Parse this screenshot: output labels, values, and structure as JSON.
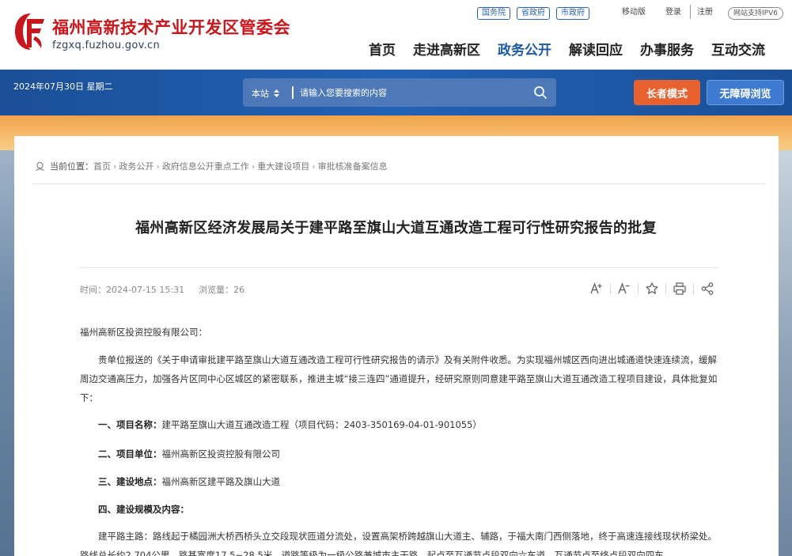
{
  "header": {
    "site_title": "福州高新技术产业开发区管委会",
    "site_url": "fzgxq.fuzhou.gov.cn",
    "top_links": [
      "国务院",
      "省政府",
      "市政府"
    ],
    "mobile": "移动版",
    "login": "登录",
    "register": "注册",
    "ipv6": "网站支持IPV6",
    "nav": [
      "首页",
      "走进高新区",
      "政务公开",
      "解读回应",
      "办事服务",
      "互动交流"
    ],
    "nav_active_index": 2
  },
  "bar": {
    "date": "2024年07月30日 星期二",
    "search_scope": "本站",
    "search_placeholder": "请输入您要搜索的内容",
    "elder_mode": "长者模式",
    "accessible": "无障碍浏览"
  },
  "breadcrumb": {
    "label": "当前位置：",
    "items": [
      "首页",
      "政务公开",
      "政府信息公开重点工作",
      "重大建设项目",
      "审批核准备案信息"
    ]
  },
  "article": {
    "title": "福州高新区经济发展局关于建平路至旗山大道互通改造工程可行性研究报告的批复",
    "time_label": "时间：",
    "time": "2024-07-15 15:31",
    "views_label": "浏览量：",
    "views": "26",
    "salutation": "福州高新区投资控股有限公司：",
    "para1": "贵单位报送的《关于申请审批建平路至旗山大道互通改造工程可行性研究报告的请示》及有关附件收悉。为实现福州城区西向进出城通道快速连续流，缓解周边交通高压力，加强各片区同中心区城区的紧密联系，推进主城“接三连四”通道提升，经研究原则同意建平路至旗山大道互通改造工程项目建设，具体批复如下：",
    "item1_label": "一、项目名称：",
    "item1_value": "建平路至旗山大道互通改造工程（项目代码：2403-350169-04-01-901055）",
    "item2_label": "二、项目单位：",
    "item2_value": "福州高新区投资控股有限公司",
    "item3_label": "三、建设地点：",
    "item3_value": "福州高新区建平路及旗山大道",
    "item4_label": "四、建设规模及内容：",
    "para_last": "建平路主路：路线起于橘园洲大桥西桥头立交段现状匝道分流处，设置高架桥跨越旗山大道主、辅路，于福大南门西侧落地，终于高速连接线现状桥梁处。路线总长约2.704公里，路基宽度17.5~28.5米，道路等级为一级公路兼城市主干路，起点至互通节点段双向六车道，互通节点至终点段双向四车"
  },
  "colors": {
    "brand_red": "#c8161d",
    "nav_blue": "#1d58a6",
    "bar_blue": "#2262b4",
    "elder_orange": "#e8612f"
  }
}
